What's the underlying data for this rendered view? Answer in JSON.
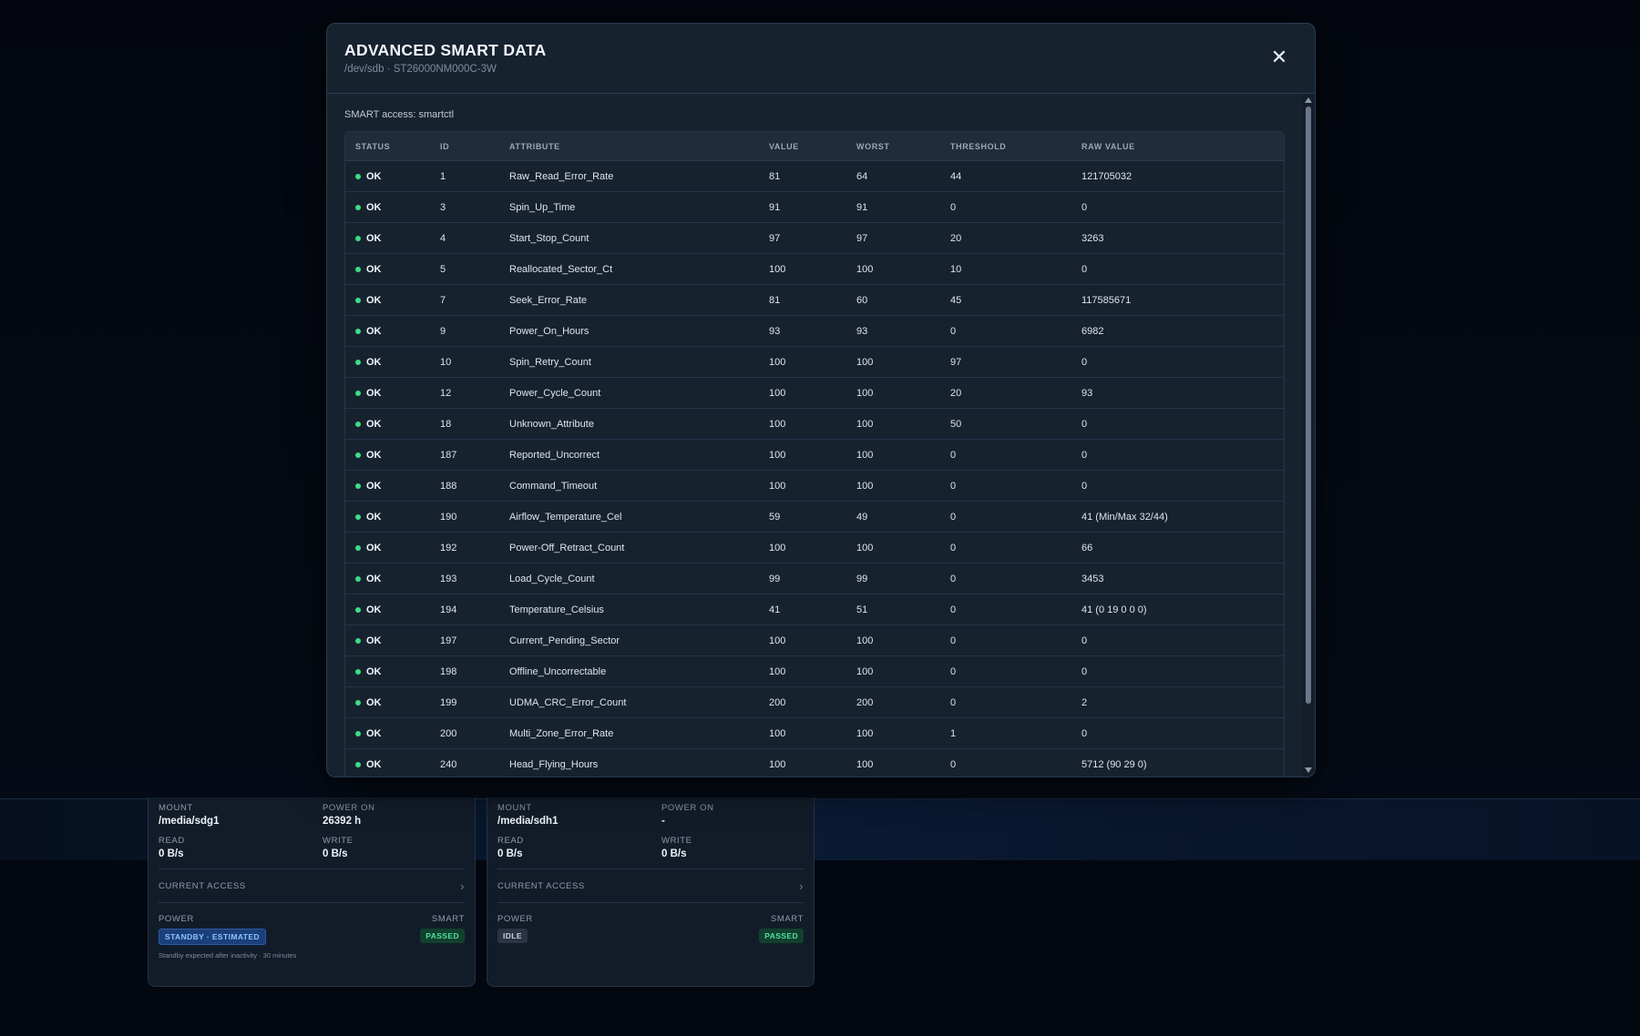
{
  "modal": {
    "title": "ADVANCED SMART DATA",
    "subtitle": "/dev/sdb · ST26000NM000C-3W",
    "close_icon": "close-icon",
    "access_note": "SMART access: smartctl"
  },
  "table": {
    "headers": {
      "status": "STATUS",
      "id": "ID",
      "attribute": "ATTRIBUTE",
      "value": "VALUE",
      "worst": "WORST",
      "threshold": "THRESHOLD",
      "raw": "RAW VALUE"
    },
    "rows": [
      {
        "status": "OK",
        "id": "1",
        "attribute": "Raw_Read_Error_Rate",
        "value": "81",
        "worst": "64",
        "threshold": "44",
        "raw": "121705032"
      },
      {
        "status": "OK",
        "id": "3",
        "attribute": "Spin_Up_Time",
        "value": "91",
        "worst": "91",
        "threshold": "0",
        "raw": "0"
      },
      {
        "status": "OK",
        "id": "4",
        "attribute": "Start_Stop_Count",
        "value": "97",
        "worst": "97",
        "threshold": "20",
        "raw": "3263"
      },
      {
        "status": "OK",
        "id": "5",
        "attribute": "Reallocated_Sector_Ct",
        "value": "100",
        "worst": "100",
        "threshold": "10",
        "raw": "0"
      },
      {
        "status": "OK",
        "id": "7",
        "attribute": "Seek_Error_Rate",
        "value": "81",
        "worst": "60",
        "threshold": "45",
        "raw": "117585671"
      },
      {
        "status": "OK",
        "id": "9",
        "attribute": "Power_On_Hours",
        "value": "93",
        "worst": "93",
        "threshold": "0",
        "raw": "6982"
      },
      {
        "status": "OK",
        "id": "10",
        "attribute": "Spin_Retry_Count",
        "value": "100",
        "worst": "100",
        "threshold": "97",
        "raw": "0"
      },
      {
        "status": "OK",
        "id": "12",
        "attribute": "Power_Cycle_Count",
        "value": "100",
        "worst": "100",
        "threshold": "20",
        "raw": "93"
      },
      {
        "status": "OK",
        "id": "18",
        "attribute": "Unknown_Attribute",
        "value": "100",
        "worst": "100",
        "threshold": "50",
        "raw": "0"
      },
      {
        "status": "OK",
        "id": "187",
        "attribute": "Reported_Uncorrect",
        "value": "100",
        "worst": "100",
        "threshold": "0",
        "raw": "0"
      },
      {
        "status": "OK",
        "id": "188",
        "attribute": "Command_Timeout",
        "value": "100",
        "worst": "100",
        "threshold": "0",
        "raw": "0"
      },
      {
        "status": "OK",
        "id": "190",
        "attribute": "Airflow_Temperature_Cel",
        "value": "59",
        "worst": "49",
        "threshold": "0",
        "raw": "41 (Min/Max 32/44)"
      },
      {
        "status": "OK",
        "id": "192",
        "attribute": "Power-Off_Retract_Count",
        "value": "100",
        "worst": "100",
        "threshold": "0",
        "raw": "66"
      },
      {
        "status": "OK",
        "id": "193",
        "attribute": "Load_Cycle_Count",
        "value": "99",
        "worst": "99",
        "threshold": "0",
        "raw": "3453"
      },
      {
        "status": "OK",
        "id": "194",
        "attribute": "Temperature_Celsius",
        "value": "41",
        "worst": "51",
        "threshold": "0",
        "raw": "41 (0 19 0 0 0)"
      },
      {
        "status": "OK",
        "id": "197",
        "attribute": "Current_Pending_Sector",
        "value": "100",
        "worst": "100",
        "threshold": "0",
        "raw": "0"
      },
      {
        "status": "OK",
        "id": "198",
        "attribute": "Offline_Uncorrectable",
        "value": "100",
        "worst": "100",
        "threshold": "0",
        "raw": "0"
      },
      {
        "status": "OK",
        "id": "199",
        "attribute": "UDMA_CRC_Error_Count",
        "value": "200",
        "worst": "200",
        "threshold": "0",
        "raw": "2"
      },
      {
        "status": "OK",
        "id": "200",
        "attribute": "Multi_Zone_Error_Rate",
        "value": "100",
        "worst": "100",
        "threshold": "1",
        "raw": "0"
      },
      {
        "status": "OK",
        "id": "240",
        "attribute": "Head_Flying_Hours",
        "value": "100",
        "worst": "100",
        "threshold": "0",
        "raw": "5712 (90 29 0)"
      }
    ]
  },
  "cards": [
    {
      "mount_label": "MOUNT",
      "mount": "/media/sdg1",
      "power_on_label": "POWER ON",
      "power_on": "26392 h",
      "read_label": "READ",
      "read": "0 B/s",
      "write_label": "WRITE",
      "write": "0 B/s",
      "access_label": "CURRENT ACCESS",
      "power_label": "POWER",
      "power_state": "STANDBY · ESTIMATED",
      "smart_label": "SMART",
      "smart_state": "PASSED",
      "hint": "Standby expected after inactivity · 30 minutes"
    },
    {
      "mount_label": "MOUNT",
      "mount": "/media/sdh1",
      "power_on_label": "POWER ON",
      "power_on": "-",
      "read_label": "READ",
      "read": "0 B/s",
      "write_label": "WRITE",
      "write": "0 B/s",
      "access_label": "CURRENT ACCESS",
      "power_label": "POWER",
      "power_state": "IDLE",
      "smart_label": "SMART",
      "smart_state": "PASSED"
    }
  ],
  "colors": {
    "ok_dot": "#3ddc84",
    "passed": "#4fe09a",
    "standby": "#8fc2ff"
  }
}
